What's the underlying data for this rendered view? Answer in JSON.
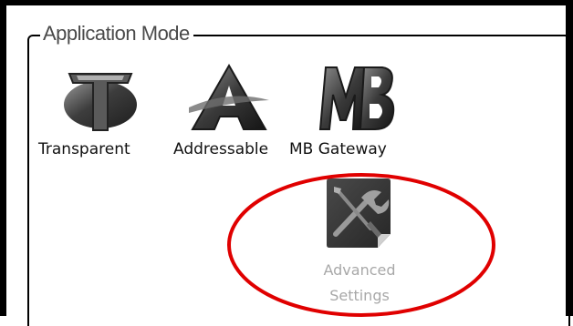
{
  "group": {
    "title": "Application Mode"
  },
  "modes": [
    {
      "label": "Transparent",
      "icon": "transparent-mode-icon"
    },
    {
      "label": "Addressable",
      "icon": "addressable-mode-icon"
    },
    {
      "label": "MB Gateway",
      "icon": "mb-gateway-mode-icon"
    }
  ],
  "advanced": {
    "label_line1": "Advanced",
    "label_line2": "Settings",
    "icon": "tools-icon",
    "state": "disabled"
  },
  "annotation": {
    "shape": "ellipse",
    "color": "#e00000"
  },
  "colors": {
    "frame": "#000000",
    "legend_text": "#4a4a4a",
    "disabled_text": "#a8a8a8",
    "icon_dark": "#3b3b3b"
  }
}
